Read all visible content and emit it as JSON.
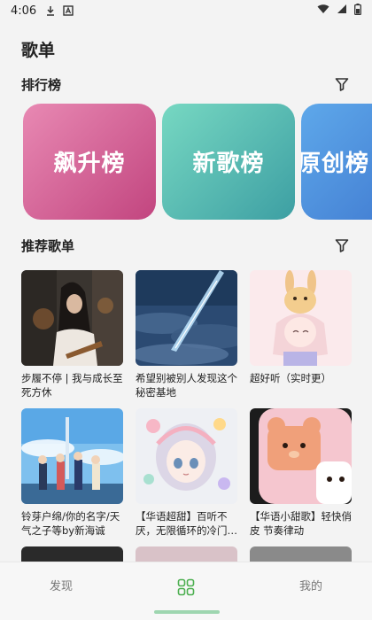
{
  "status_bar": {
    "time": "4:06",
    "icons": [
      "download-icon",
      "a-box-icon",
      "wifi-icon",
      "signal-icon",
      "battery-icon"
    ]
  },
  "page": {
    "title": "歌单"
  },
  "ranking": {
    "title": "排行榜",
    "filter_icon": "filter-icon",
    "cards": [
      {
        "label": "飙升榜",
        "color_from": "#e889b3",
        "color_to": "#c2457f"
      },
      {
        "label": "新歌榜",
        "color_from": "#77d8c2",
        "color_to": "#3d9fa3"
      },
      {
        "label": "原创榜",
        "color_from": "#5ea8ea",
        "color_to": "#3f78cf"
      }
    ]
  },
  "recommend": {
    "title": "推荐歌单",
    "filter_icon": "filter-icon",
    "playlists": [
      {
        "title": "步履不停 | 我与成长至死方休"
      },
      {
        "title": "希望别被别人发现这个秘密基地"
      },
      {
        "title": "超好听（实时更）"
      },
      {
        "title": "铃芽户绵/你的名字/天气之子等by新海诚"
      },
      {
        "title": "【华语超甜】百听不厌，无限循环的冷门…"
      },
      {
        "title": "【华语小甜歌】轻快俏皮 节奏律动"
      }
    ]
  },
  "bottom_nav": {
    "left_label": "发现",
    "right_label": "我的",
    "center_icon": "grid-icon",
    "accent": "#4caf50"
  }
}
